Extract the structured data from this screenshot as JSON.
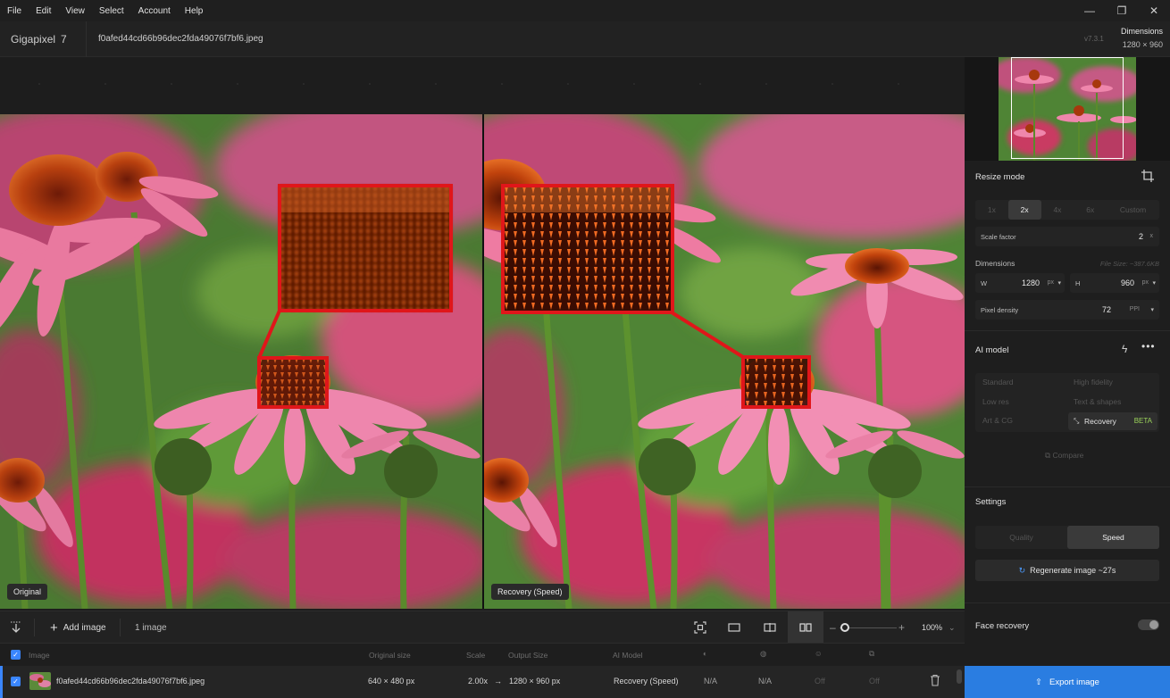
{
  "menu": {
    "items": [
      "File",
      "Edit",
      "View",
      "Select",
      "Account",
      "Help"
    ]
  },
  "window": {
    "minimize": "—",
    "restore": "❐",
    "close": "✕"
  },
  "title": {
    "app_name": "Gigapixel",
    "app_version": "7",
    "file_name": "f0afed44cd66b96dec2fda49076f7bf6.jpeg",
    "version_tag": "v7.3.1",
    "dims_title": "Dimensions",
    "dims_value": "1280 × 960"
  },
  "canvas": {
    "left_label": "Original",
    "right_label": "Recovery (Speed)"
  },
  "toolbar": {
    "add_image": "Add image",
    "count": "1 image",
    "zoom": "100%"
  },
  "list": {
    "headers": {
      "image": "Image",
      "original_size": "Original size",
      "scale": "Scale",
      "output_size": "Output Size",
      "ai_model": "AI Model"
    },
    "row": {
      "file_name": "f0afed44cd66b96dec2fda49076f7bf6.jpeg",
      "original_size": "640 × 480 px",
      "scale": "2.00x",
      "arrow": "→",
      "output_size": "1280 × 960 px",
      "ai_model": "Recovery (Speed)",
      "col1": "N/A",
      "col2": "N/A",
      "col3": "Off",
      "col4": "Off"
    }
  },
  "panel": {
    "resize_mode": {
      "title": "Resize mode",
      "options": [
        "1x",
        "2x",
        "4x",
        "6x",
        "Custom"
      ],
      "selected": "2x"
    },
    "scale_factor": {
      "label": "Scale factor",
      "value": "2",
      "unit": "x"
    },
    "dimensions": {
      "title": "Dimensions",
      "file_size": "File Size: ~387.6KB",
      "w_label": "W",
      "w_value": "1280",
      "w_unit": "px",
      "h_label": "H",
      "h_value": "960",
      "h_unit": "px"
    },
    "pixel_density": {
      "label": "Pixel density",
      "value": "72",
      "unit": "PPI"
    },
    "ai_model": {
      "title": "AI model",
      "options": {
        "standard": "Standard",
        "high_fidelity": "High fidelity",
        "low_res": "Low res",
        "text_shapes": "Text & shapes",
        "art_cg": "Art & CG",
        "recovery": "Recovery",
        "beta": "BETA"
      },
      "compare": "Compare"
    },
    "settings": {
      "title": "Settings",
      "quality": "Quality",
      "speed": "Speed",
      "regenerate": "Regenerate image ~27s"
    },
    "face_recovery": {
      "label": "Face recovery",
      "enabled": false
    },
    "export": "Export image"
  },
  "colors": {
    "accent": "#3a86ff",
    "export": "#2a7de1",
    "beta": "#9bd35a",
    "highlight_box": "#e0161a"
  }
}
